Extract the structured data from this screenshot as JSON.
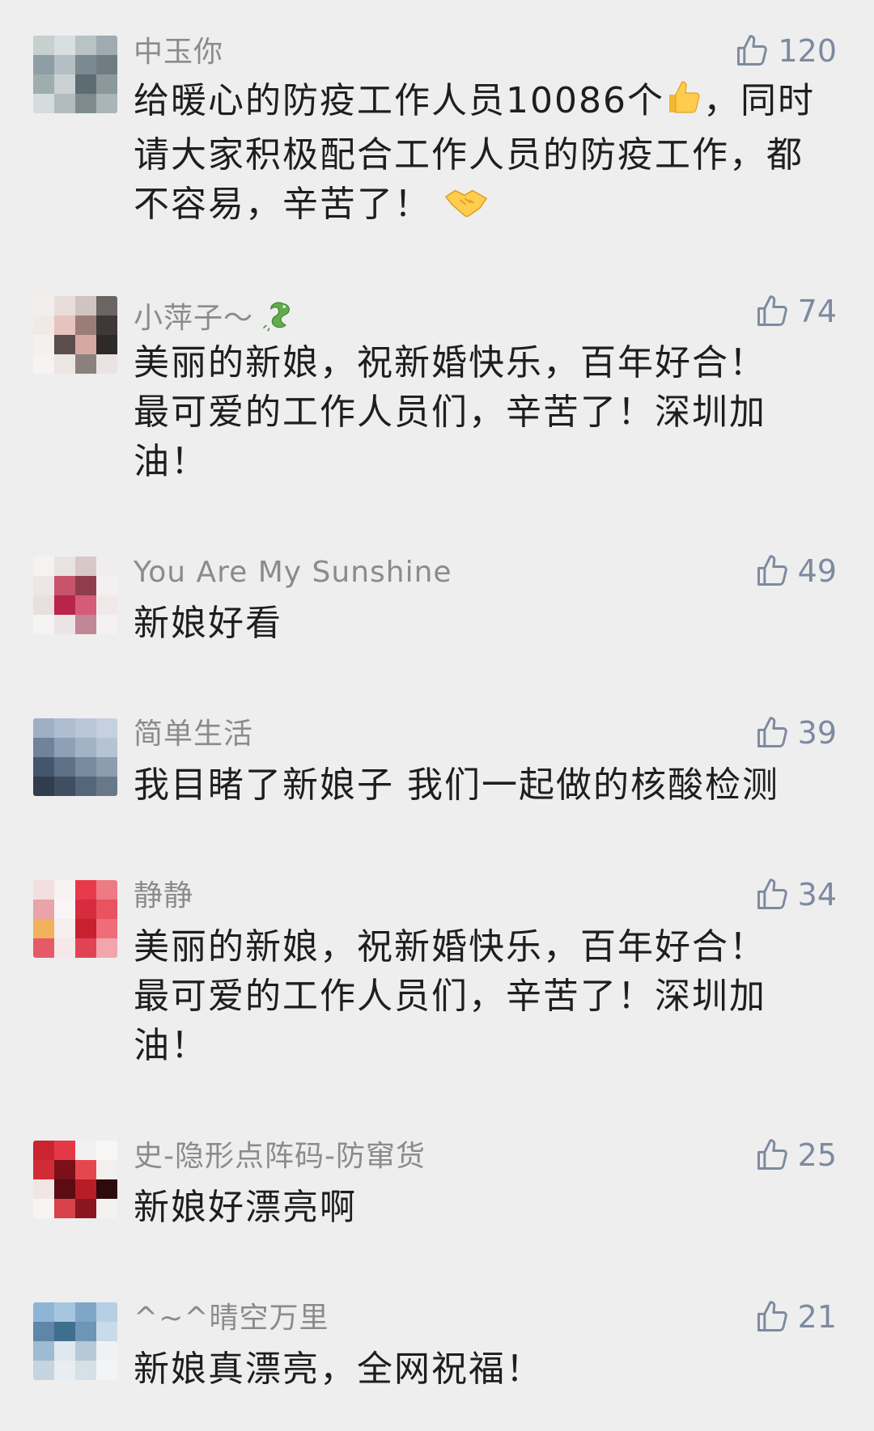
{
  "comments": [
    {
      "username": "中玉你",
      "likes": "120",
      "text_parts": [
        "给暖心的防疫工作人员10086个",
        "，同时请大家积极配合工作人员的防疫工作，都不容易，辛苦了！ "
      ],
      "emojis": [
        "thumbs-up-emoji",
        "handshake-emoji"
      ]
    },
    {
      "username": "小萍子～",
      "likes": "74",
      "text": "美丽的新娘，祝新婚快乐，百年好合！最可爱的工作人员们，辛苦了！深圳加油！",
      "emojis": [
        "dragon-emoji"
      ]
    },
    {
      "username": "You Are My Sunshine",
      "likes": "49",
      "text": "新娘好看"
    },
    {
      "username": "简单生活",
      "likes": "39",
      "text": "我目睹了新娘子 我们一起做的核酸检测"
    },
    {
      "username": "静静",
      "likes": "34",
      "text": "美丽的新娘，祝新婚快乐，百年好合！最可爱的工作人员们，辛苦了！深圳加油！"
    },
    {
      "username": "史-隐形点阵码-防窜货",
      "likes": "25",
      "text": "新娘好漂亮啊"
    },
    {
      "username": "^~^晴空万里",
      "likes": "21",
      "text": "新娘真漂亮，全网祝福！"
    }
  ],
  "colors": {
    "background": "#eeeeee",
    "username": "#8b8b8b",
    "like": "#7d8aa0",
    "text": "#1e1e1e"
  }
}
